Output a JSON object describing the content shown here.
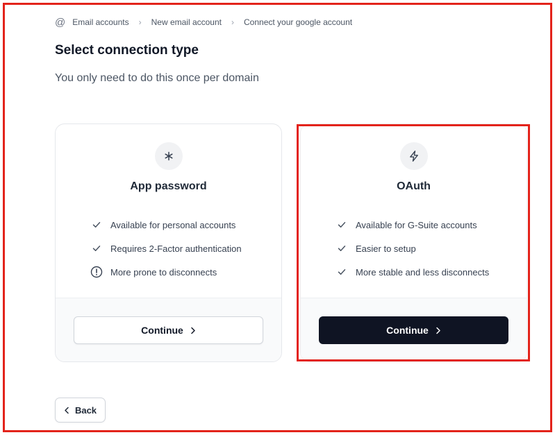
{
  "breadcrumb": {
    "items": [
      "Email accounts",
      "New email account",
      "Connect your google account"
    ]
  },
  "page": {
    "title": "Select connection type",
    "subtitle": "You only need to do this once per domain"
  },
  "options": [
    {
      "title": "App password",
      "icon": "asterisk-icon",
      "features": [
        {
          "icon": "check-icon",
          "text": "Available for personal accounts"
        },
        {
          "icon": "check-icon",
          "text": "Requires 2-Factor authentication"
        },
        {
          "icon": "alert-circle-icon",
          "text": "More prone to disconnects"
        }
      ],
      "button_label": "Continue",
      "button_style": "secondary"
    },
    {
      "title": "OAuth",
      "icon": "lightning-icon",
      "features": [
        {
          "icon": "check-icon",
          "text": "Available for G-Suite accounts"
        },
        {
          "icon": "check-icon",
          "text": "Easier to setup"
        },
        {
          "icon": "check-icon",
          "text": "More stable and less disconnects"
        }
      ],
      "button_label": "Continue",
      "button_style": "primary"
    }
  ],
  "footer": {
    "back_label": "Back"
  },
  "colors": {
    "highlight": "#e3231b",
    "primary_button": "#0f1423",
    "text": "#111827",
    "muted": "#4b5563"
  }
}
